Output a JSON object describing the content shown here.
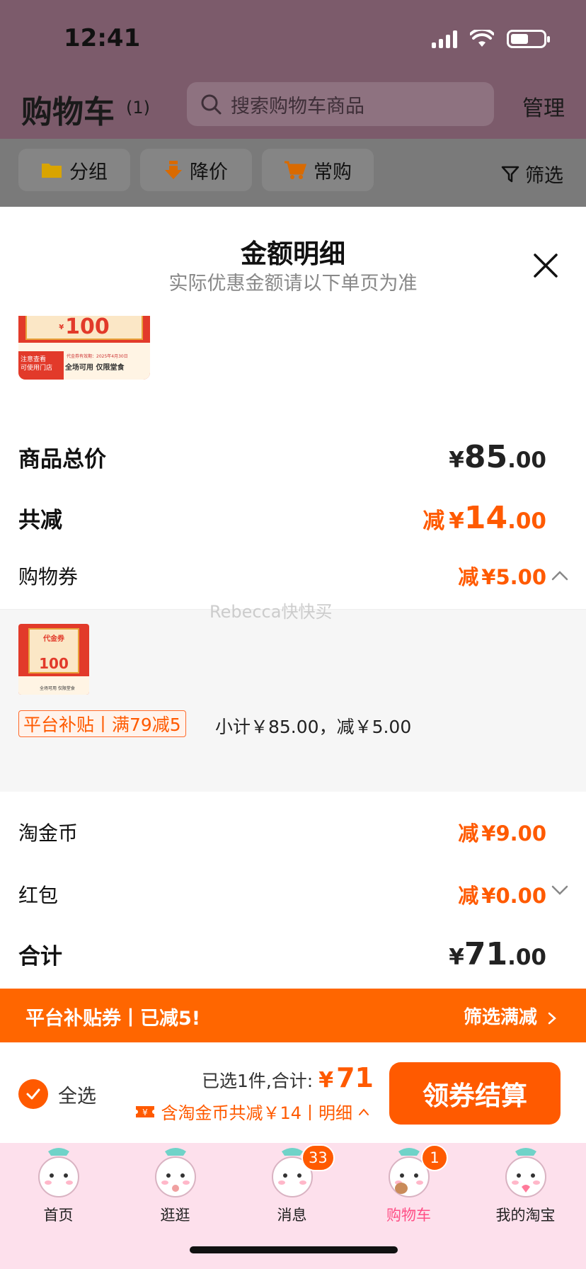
{
  "status_bar": {
    "time": "12:41"
  },
  "header": {
    "title": "购物车",
    "count": "(1)",
    "search_placeholder": "搜索购物车商品",
    "manage": "管理"
  },
  "filters": {
    "chips": [
      "分组",
      "降价",
      "常购"
    ],
    "filter_label": "筛选"
  },
  "sheet": {
    "title": "金额明细",
    "subtitle": "实际优惠金额请以下单页为准",
    "coupon_image": {
      "value": "100",
      "note_line1": "注意查看",
      "note_line2": "可使用门店",
      "slogan": "全场可用 仅限堂食",
      "validity": "代金券有效期：2025年4月30日",
      "title": "代金券"
    },
    "rows": {
      "goods_total": {
        "label": "商品总价",
        "currency": "¥",
        "integer": "85",
        "decimal": ".00"
      },
      "total_discount": {
        "label": "共减",
        "prefix": "减",
        "currency": "¥",
        "integer": "14",
        "decimal": ".00"
      },
      "shopping_coupon": {
        "label": "购物券",
        "prefix": "减",
        "currency": "¥",
        "integer": "5",
        "decimal": ".00"
      },
      "taojinbi": {
        "label": "淘金币",
        "prefix": "减",
        "currency": "¥",
        "integer": "9",
        "decimal": ".00"
      },
      "red_packet": {
        "label": "红包",
        "prefix": "减",
        "currency": "¥",
        "integer": "0",
        "decimal": ".00"
      },
      "grand_total": {
        "label": "合计",
        "currency": "¥",
        "integer": "71",
        "decimal": ".00"
      }
    },
    "detail": {
      "tag": "平台补贴丨满79减5",
      "subtotal": "小计￥85.00，减￥5.00",
      "watermark": "Rebecca快快买"
    }
  },
  "banner": {
    "left": "平台补贴券丨已减5!",
    "right": "筛选满减"
  },
  "checkout": {
    "select_all": "全选",
    "selected_text": "已选1件,合计:",
    "currency": "¥",
    "total": "71",
    "discount_text": "含淘金币共减￥14丨明细",
    "button": "领券结算"
  },
  "tabbar": {
    "tabs": [
      {
        "label": "首页",
        "badge": ""
      },
      {
        "label": "逛逛",
        "badge": ""
      },
      {
        "label": "消息",
        "badge": "33"
      },
      {
        "label": "购物车",
        "badge": "1"
      },
      {
        "label": "我的淘宝",
        "badge": ""
      }
    ]
  },
  "colors": {
    "accent": "#ff5a00",
    "banner": "#ff6600",
    "tab_active": "#ff4f86",
    "tabbar_bg": "#fde0ec"
  }
}
